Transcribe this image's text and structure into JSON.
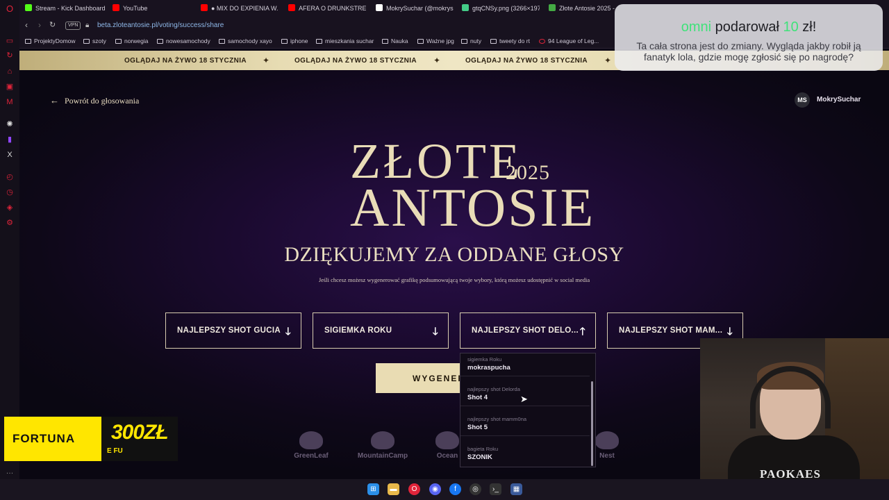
{
  "browser": {
    "tabs": [
      {
        "label": "Stream - Kick Dashboard",
        "color": "#53fc18"
      },
      {
        "label": "YouTube",
        "color": "#ff0000"
      },
      {
        "label": "● MIX DO EXPIENIA W...",
        "color": "#ff0000"
      },
      {
        "label": "AFERA O DRUNKSTREAM",
        "color": "#ff0000"
      },
      {
        "label": "MokrySuchar (@mokrysu",
        "color": "#ffffff"
      },
      {
        "label": "gtqCNSy.png (3266×197",
        "color": "#44cc88"
      },
      {
        "label": "Złote Antosie 2025 - ...",
        "color": "#44aa44"
      }
    ],
    "vpn_label": "VPN",
    "url": "beta.zloteantosie.pl/voting/success/share",
    "bookmarks": [
      "ProjektyDomow",
      "szoty",
      "norwegia",
      "nowesamochody",
      "samochody xayo",
      "iphone",
      "mieszkania suchar",
      "Nauka",
      "Ważne jpg",
      "nuty",
      "tweety do rt",
      "94 League of Leg..."
    ]
  },
  "page": {
    "marquee_text": "OGLĄDAJ NA ŻYWO 18 STYCZNIA",
    "back_label": "Powrót do głosowania",
    "user": {
      "initials": "MS",
      "name": "MokrySuchar"
    },
    "logo": {
      "line1": "ZŁOTE",
      "year": "2025",
      "line2": "ANTOSIE"
    },
    "heading": "DZIĘKUJEMY ZA ODDANE GŁOSY",
    "subtitle": "Jeśli chcesz możesz wygenerować grafikę podsumowującą twoje wybory, którą możesz udostępnić w social media",
    "categories": [
      {
        "label": "NAJLEPSZY SHOT GUCIA",
        "arrow": "down"
      },
      {
        "label": "SIGIEMKA ROKU",
        "arrow": "down"
      },
      {
        "label": "NAJLEPSZY SHOT DELO...",
        "arrow": "up"
      },
      {
        "label": "NAJLEPSZY SHOT MAM...",
        "arrow": "down"
      }
    ],
    "generate_label": "WYGENER",
    "dropdown": [
      {
        "category": "sigiemka Roku",
        "value": "mokraspucha"
      },
      {
        "category": "najlepszy shot Delorda",
        "value": "Shot 4"
      },
      {
        "category": "najlepszy shot mamm0na",
        "value": "Shot 5"
      },
      {
        "category": "bagieta Roku",
        "value": "SZONIK"
      }
    ],
    "sponsors": [
      "GreenLeaf",
      "MountainCamp",
      "Ocean",
      "Nest"
    ]
  },
  "overlays": {
    "donation": {
      "user": "omni",
      "action": "podarował",
      "amount": "10",
      "currency": "zł!",
      "message": "Ta cała strona jest do zmiany. Wygląda jakby robił ją fanatyk lola, gdzie mogę zgłosić się po nagrodę?"
    },
    "fortuna": {
      "brand": "FORTUNA",
      "amount": "300ZŁ",
      "small": "E FU"
    },
    "webcam_shirt": "PAOKAES"
  },
  "colors": {
    "gold": "#e9dcb3",
    "page_bg": "#1a0a2e",
    "donation_green": "#3fe27a",
    "fortuna_yellow": "#ffe600"
  }
}
